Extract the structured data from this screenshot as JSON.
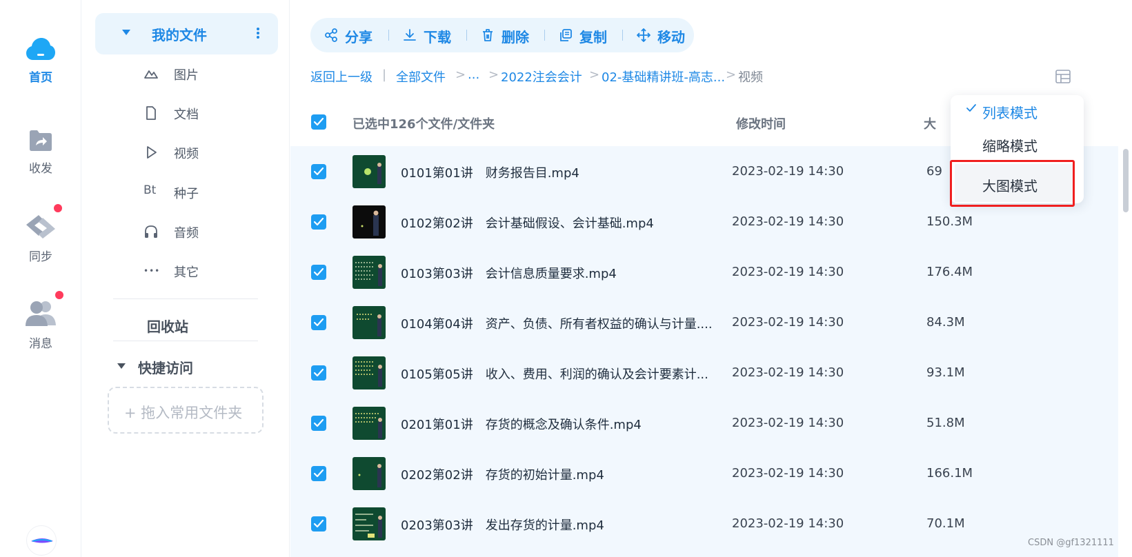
{
  "rail": {
    "items": [
      {
        "label": "首页",
        "icon": "cloud-icon",
        "active": true
      },
      {
        "label": "收发",
        "icon": "folder-share-icon",
        "active": false
      },
      {
        "label": "同步",
        "icon": "sync-icon",
        "active": false
      },
      {
        "label": "消息",
        "icon": "users-icon",
        "active": false
      }
    ],
    "colors": {
      "accent": "#1e88e5",
      "badge": "#ff3b5c"
    }
  },
  "sidebar": {
    "my_files": "我的文件",
    "categories": [
      {
        "label": "图片",
        "icon": "image-icon"
      },
      {
        "label": "文档",
        "icon": "document-icon"
      },
      {
        "label": "视频",
        "icon": "video-icon"
      },
      {
        "label": "种子",
        "icon": "torrent-icon"
      },
      {
        "label": "音频",
        "icon": "headphones-icon"
      },
      {
        "label": "其它",
        "icon": "more-icon"
      }
    ],
    "torrent_glyph": "Bt",
    "more_glyph": "•••",
    "recycle": "回收站",
    "quick_access": "快捷访问",
    "drop_zone": "+ 拖入常用文件夹"
  },
  "toolbar": {
    "share": "分享",
    "download": "下载",
    "delete": "删除",
    "copy": "复制",
    "move": "移动"
  },
  "breadcrumb": {
    "back": "返回上一级",
    "all_files": "全部文件",
    "ellipsis": "...",
    "level1": "2022注会会计",
    "level2": "02-基础精讲班-高志...",
    "current": "视频",
    "sep1": "|",
    "sep": ">"
  },
  "table": {
    "selected_label": "已选中126个文件/文件夹",
    "col_time": "修改时间",
    "col_size": "大",
    "rows": [
      {
        "name": "0101第01讲　财务报告目.mp4",
        "time": "2023-02-19 14:30",
        "size": "69"
      },
      {
        "name": "0102第02讲　会计基础假设、会计基础.mp4",
        "time": "2023-02-19 14:30",
        "size": "150.3M"
      },
      {
        "name": "0103第03讲　会计信息质量要求.mp4",
        "time": "2023-02-19 14:30",
        "size": "176.4M"
      },
      {
        "name": "0104第04讲　资产、负债、所有者权益的确认与计量....",
        "time": "2023-02-19 14:30",
        "size": "84.3M"
      },
      {
        "name": "0105第05讲　收入、费用、利润的确认及会计要素计...",
        "time": "2023-02-19 14:30",
        "size": "93.1M"
      },
      {
        "name": "0201第01讲　存货的概念及确认条件.mp4",
        "time": "2023-02-19 14:30",
        "size": "51.8M"
      },
      {
        "name": "0202第02讲　存货的初始计量.mp4",
        "time": "2023-02-19 14:30",
        "size": "166.1M"
      },
      {
        "name": "0203第03讲　发出存货的计量.mp4",
        "time": "2023-02-19 14:30",
        "size": "70.1M"
      }
    ]
  },
  "view_menu": {
    "items": [
      "列表模式",
      "缩略模式",
      "大图模式"
    ],
    "selected": "列表模式",
    "highlighted": "大图模式",
    "highlight_color": "#f01f1f"
  },
  "watermark": "CSDN @gf1321111"
}
